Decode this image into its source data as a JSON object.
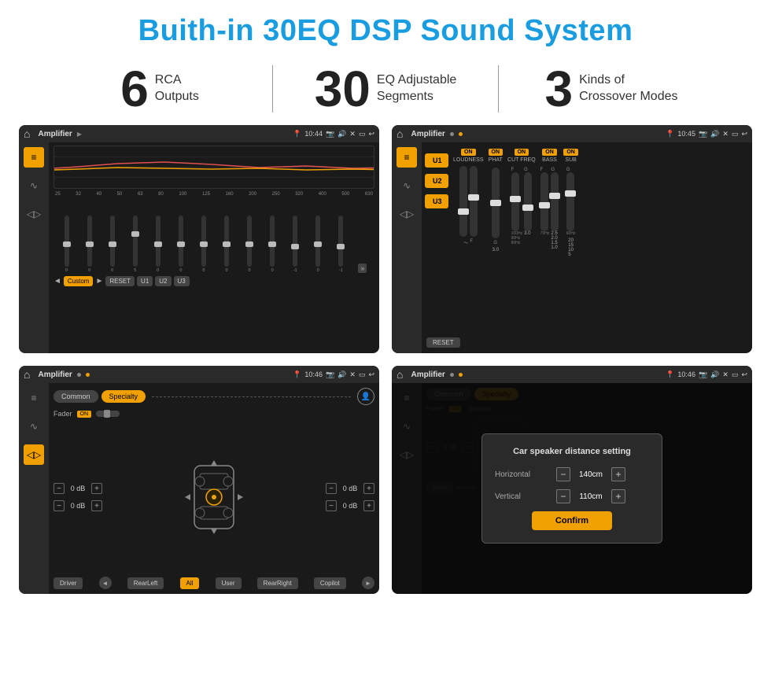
{
  "page": {
    "title": "Buith-in 30EQ DSP Sound System"
  },
  "stats": [
    {
      "number": "6",
      "label": "RCA\nOutputs"
    },
    {
      "number": "30",
      "label": "EQ Adjustable\nSegments"
    },
    {
      "number": "3",
      "label": "Kinds of\nCrossover Modes"
    }
  ],
  "screens": [
    {
      "id": "screen1",
      "status_bar": {
        "title": "Amplifier",
        "time": "10:44"
      },
      "type": "eq"
    },
    {
      "id": "screen2",
      "status_bar": {
        "title": "Amplifier",
        "time": "10:45"
      },
      "type": "amp-settings"
    },
    {
      "id": "screen3",
      "status_bar": {
        "title": "Amplifier",
        "time": "10:46"
      },
      "type": "fader"
    },
    {
      "id": "screen4",
      "status_bar": {
        "title": "Amplifier",
        "time": "10:46"
      },
      "type": "dialog"
    }
  ],
  "eq_screen": {
    "freq_labels": [
      "25",
      "32",
      "40",
      "50",
      "63",
      "80",
      "100",
      "125",
      "160",
      "200",
      "250",
      "320",
      "400",
      "500",
      "630"
    ],
    "slider_values": [
      "0",
      "0",
      "0",
      "5",
      "0",
      "0",
      "0",
      "0",
      "0",
      "0",
      "-1",
      "0",
      "-1"
    ],
    "buttons": [
      "Custom",
      "RESET",
      "U1",
      "U2",
      "U3"
    ]
  },
  "amp_screen": {
    "u_buttons": [
      "U1",
      "U2",
      "U3"
    ],
    "sections": [
      "LOUDNESS",
      "PHAT",
      "CUT FREQ",
      "BASS",
      "SUB"
    ],
    "on_labels": [
      "ON",
      "ON",
      "ON",
      "ON",
      "ON"
    ]
  },
  "fader_screen": {
    "tabs": [
      "Common",
      "Specialty"
    ],
    "fader_label": "Fader",
    "on_label": "ON",
    "db_values": [
      "0 dB",
      "0 dB",
      "0 dB",
      "0 dB"
    ],
    "positions": [
      "Driver",
      "RearLeft",
      "All",
      "User",
      "RearRight",
      "Copilot"
    ]
  },
  "dialog_screen": {
    "title": "Car speaker distance setting",
    "fields": [
      {
        "label": "Horizontal",
        "value": "140cm"
      },
      {
        "label": "Vertical",
        "value": "110cm"
      }
    ],
    "confirm_label": "Confirm"
  }
}
